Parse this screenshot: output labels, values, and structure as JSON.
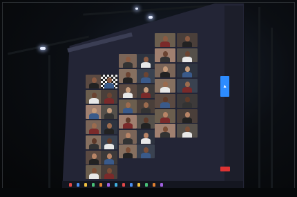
{
  "scene": {
    "description_free": true,
    "colors": {
      "screen_bg": "#232536",
      "share_button": "#2d8cff",
      "end_button": "#dd3333",
      "toolbar": "#141620"
    },
    "icons": [
      "share-screen-icon",
      "end-call-icon",
      "taskbar-app-icon"
    ]
  }
}
